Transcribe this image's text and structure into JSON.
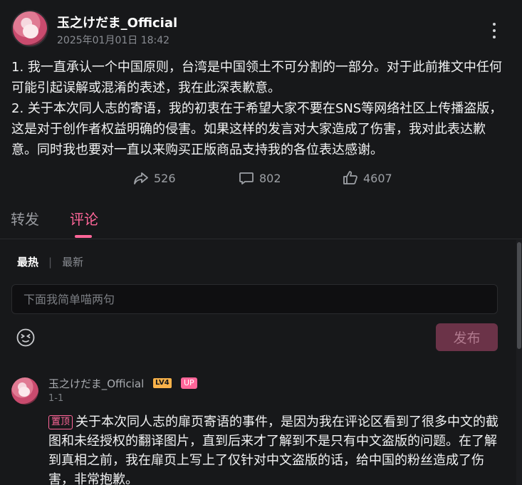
{
  "post": {
    "author": "玉之けだま_Official",
    "time": "2025年01月01日 18:42",
    "paragraph1": "1. 我一直承认一个中国原则，台湾是中国领土不可分割的一部分。对于此前推文中任何可能引起误解或混淆的表述，我在此深表歉意。",
    "paragraph2": "2. 关于本次同人志的寄语，我的初衷在于希望大家不要在SNS等网络社区上传播盗版，这是对于创作者权益明确的侵害。如果这样的发言对大家造成了伤害，我对此表达歉意。同时我也要对一直以来购买正版商品支持我的各位表达感谢。"
  },
  "actions": {
    "repost_count": "526",
    "comment_count": "802",
    "like_count": "4607"
  },
  "tabs": {
    "repost": "转发",
    "comment": "评论"
  },
  "sort": {
    "hot": "最热",
    "separator": "|",
    "new": "最新"
  },
  "comment_box": {
    "placeholder": "下面我简单喵两句",
    "send": "发布"
  },
  "comment": {
    "author": "玉之けだま_Official",
    "level": "LV4",
    "up_badge": "UP",
    "floor": "1-1",
    "pin_label": "置顶",
    "text": "关于本次同人志的扉页寄语的事件，是因为我在评论区看到了很多中文的截图和未经授权的翻译图片，直到后来才了解到不是只有中文盗版的问题。在了解到真相之前，我在扉页上写上了仅针对中文盗版的话，给中国的粉丝造成了伤害，非常抱歉。"
  },
  "colors": {
    "accent": "#ff6699",
    "background": "#17181a"
  }
}
